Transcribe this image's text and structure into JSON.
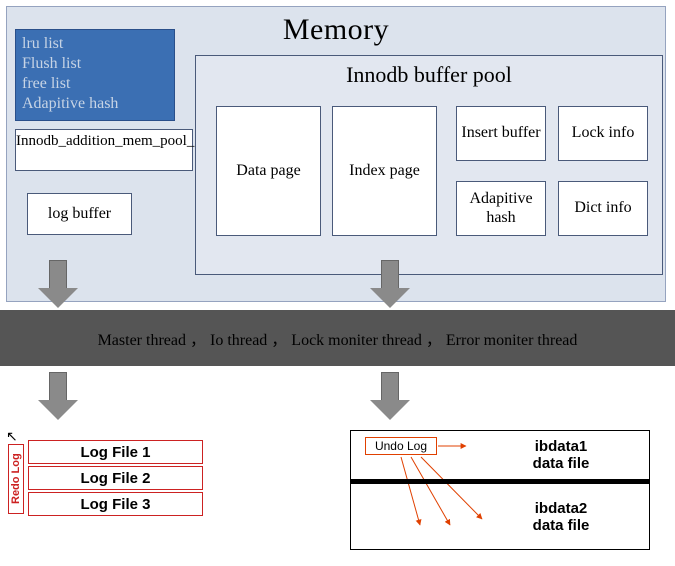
{
  "memory": {
    "title": "Memory",
    "blue_box": {
      "lines": [
        "lru list",
        "Flush list",
        "free list",
        "Adapitive hash"
      ]
    },
    "mem_pool_label": "Innodb_addition_mem_pool_size",
    "log_buffer_label": "log buffer",
    "buffer_pool": {
      "title": "Innodb buffer pool",
      "cells": {
        "data_page": "Data page",
        "index_page": "Index page",
        "insert_buffer": "Insert buffer",
        "lock_info": "Lock info",
        "adaptive_hash": "Adapitive hash",
        "dict_info": "Dict info"
      }
    }
  },
  "threads": {
    "text": "Master thread ，  Io thread  ，  Lock moniter thread   ，  Error moniter thread"
  },
  "redo_log": {
    "side_label": "Redo Log",
    "files": [
      "Log File 1",
      "Log File 2",
      "Log File 3"
    ]
  },
  "ibdata": {
    "undo_label": "Undo Log",
    "file1": {
      "name": "ibdata1",
      "subtitle": "data file"
    },
    "file2": {
      "name": "ibdata2",
      "subtitle": "data file"
    }
  }
}
